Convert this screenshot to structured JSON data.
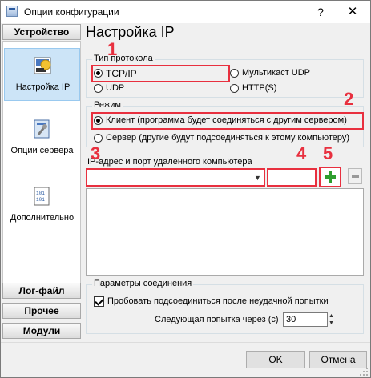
{
  "window": {
    "title": "Опции конфигурации",
    "help_label": "?",
    "close_label": "✕"
  },
  "sidebar": {
    "top_category": "Устройство",
    "items": [
      {
        "label": "Настройка IP",
        "icon": "network-config-icon",
        "selected": true
      },
      {
        "label": "Опции сервера",
        "icon": "server-options-icon",
        "selected": false
      },
      {
        "label": "Дополнительно",
        "icon": "advanced-icon",
        "selected": false
      }
    ],
    "bottom_categories": [
      "Лог-файл",
      "Прочее",
      "Модули"
    ]
  },
  "main": {
    "title": "Настройка IP",
    "protocol": {
      "label": "Тип протокола",
      "options": [
        {
          "label": "TCP/IP",
          "checked": true
        },
        {
          "label": "Мультикаст UDP",
          "checked": false
        },
        {
          "label": "UDP",
          "checked": false
        },
        {
          "label": "HTTP(S)",
          "checked": false
        }
      ]
    },
    "mode": {
      "label": "Режим",
      "options": [
        {
          "label": "Клиент (программа будет соединяться с другим сервером)",
          "checked": true
        },
        {
          "label": "Сервер (другие будут подсоединяться к этому компьютеру)",
          "checked": false
        }
      ]
    },
    "remote": {
      "label": "IP-адрес и порт удаленного компьютера",
      "address_value": "",
      "port_value": ""
    },
    "connection": {
      "label": "Параметры соединения",
      "retry_label": "Пробовать подсоединиться после неудачной попытки",
      "retry_checked": true,
      "next_attempt_label": "Следующая попытка через (с)",
      "next_attempt_value": "30"
    }
  },
  "annotations": [
    "1",
    "2",
    "3",
    "4",
    "5"
  ],
  "footer": {
    "ok_label": "OK",
    "cancel_label": "Отмена"
  },
  "colors": {
    "annotation_red": "#e8303f",
    "selection_blue": "#cce4f7",
    "plus_green": "#2e9e2e"
  }
}
